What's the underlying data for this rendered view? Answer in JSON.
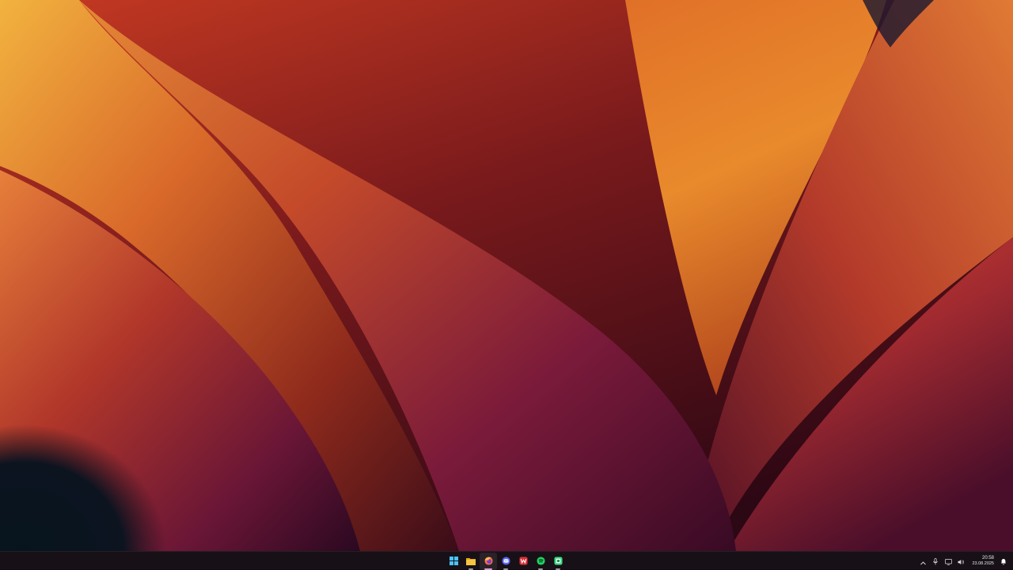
{
  "desktop": {
    "wallpaper": "orange-purple-abstract-wallpaper"
  },
  "taskbar": {
    "apps": [
      {
        "name": "start",
        "icon": "windows-logo-icon",
        "color": "#4cc2ff"
      },
      {
        "name": "file-explorer",
        "icon": "folder-icon",
        "color": "#f5c542"
      },
      {
        "name": "firefox",
        "icon": "firefox-icon",
        "color": "#ff7139",
        "active": true
      },
      {
        "name": "discord",
        "icon": "discord-icon",
        "color": "#5865f2"
      },
      {
        "name": "wps-office",
        "icon": "wps-icon",
        "color": "#e0303a"
      },
      {
        "name": "spotify",
        "icon": "spotify-icon",
        "color": "#1ed760"
      },
      {
        "name": "android-app",
        "icon": "android-icon",
        "color": "#3ddc84"
      }
    ],
    "tray": {
      "icons": [
        "chevron-up-icon",
        "microphone-icon",
        "network-icon",
        "volume-icon"
      ],
      "time": "20:58",
      "date": "23.08.2025",
      "notification_icon": "notification-bell-icon"
    }
  }
}
